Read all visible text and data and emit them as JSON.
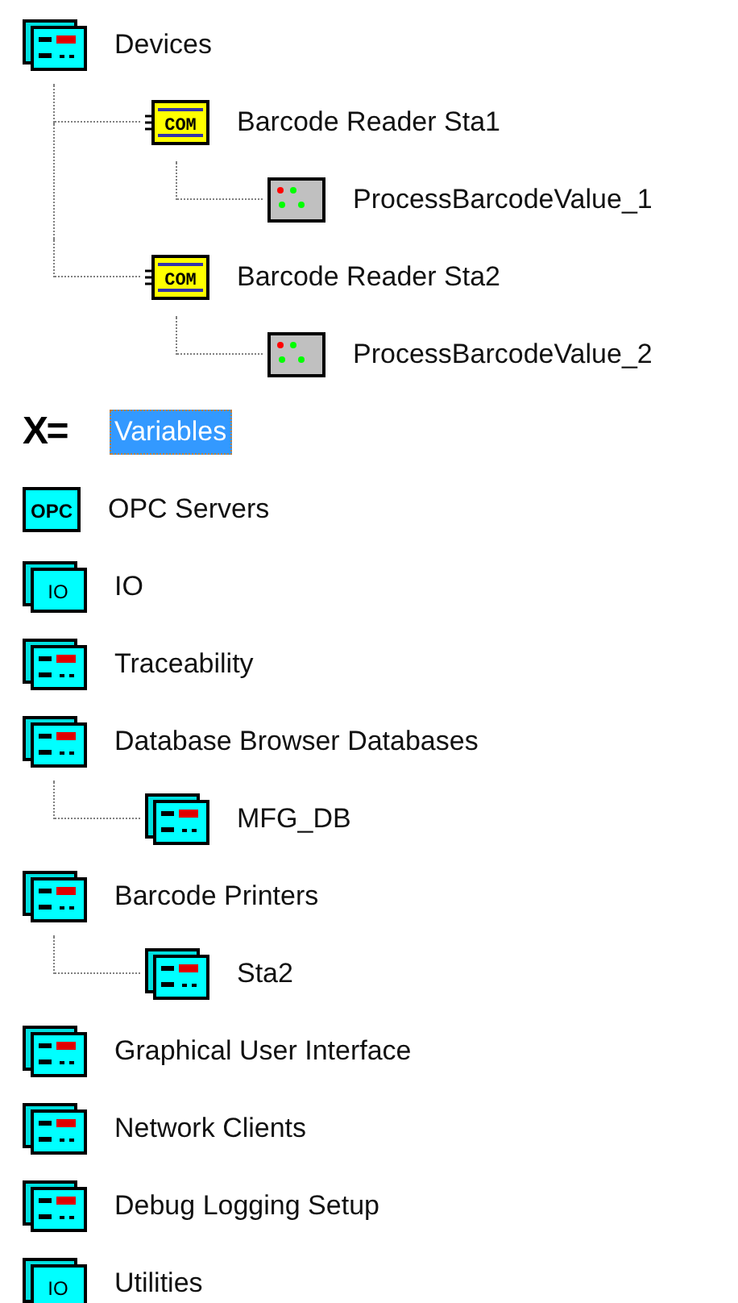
{
  "tree": [
    {
      "label": "Devices",
      "kind": "panel",
      "selected": false,
      "children": [
        {
          "label": "Barcode Reader Sta1",
          "kind": "com",
          "icon_text": "COM",
          "selected": false,
          "children": [
            {
              "label": "ProcessBarcodeValue_1",
              "kind": "process",
              "selected": false
            }
          ]
        },
        {
          "label": "Barcode Reader Sta2",
          "kind": "com",
          "icon_text": "COM",
          "selected": false,
          "children": [
            {
              "label": "ProcessBarcodeValue_2",
              "kind": "process",
              "selected": false
            }
          ]
        }
      ]
    },
    {
      "label": "Variables",
      "kind": "variable",
      "icon_text": "X=",
      "selected": true
    },
    {
      "label": "OPC Servers",
      "kind": "opc",
      "icon_text": "OPC",
      "selected": false
    },
    {
      "label": "IO",
      "kind": "io",
      "icon_text": "IO",
      "selected": false
    },
    {
      "label": "Traceability",
      "kind": "panel",
      "selected": false
    },
    {
      "label": "Database Browser Databases",
      "kind": "panel",
      "selected": false,
      "children": [
        {
          "label": "MFG_DB",
          "kind": "panel",
          "selected": false
        }
      ]
    },
    {
      "label": "Barcode Printers",
      "kind": "panel",
      "selected": false,
      "children": [
        {
          "label": "Sta2",
          "kind": "panel",
          "selected": false
        }
      ]
    },
    {
      "label": "Graphical User Interface",
      "kind": "panel",
      "selected": false
    },
    {
      "label": "Network Clients",
      "kind": "panel",
      "selected": false
    },
    {
      "label": "Debug Logging Setup",
      "kind": "panel",
      "selected": false
    },
    {
      "label": "Utilities",
      "kind": "io",
      "icon_text": "IO",
      "selected": false
    }
  ]
}
